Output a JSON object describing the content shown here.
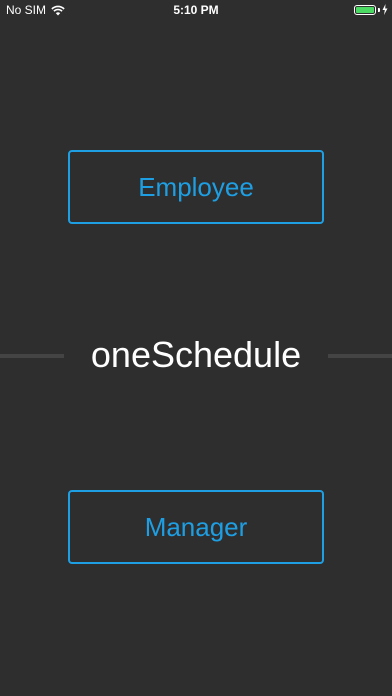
{
  "status_bar": {
    "carrier": "No SIM",
    "time": "5:10 PM",
    "battery_color": "#4cd964"
  },
  "main": {
    "app_title": "oneSchedule",
    "employee_button_label": "Employee",
    "manager_button_label": "Manager",
    "accent_color": "#1e9fe3",
    "background_color": "#2e2e2e"
  }
}
